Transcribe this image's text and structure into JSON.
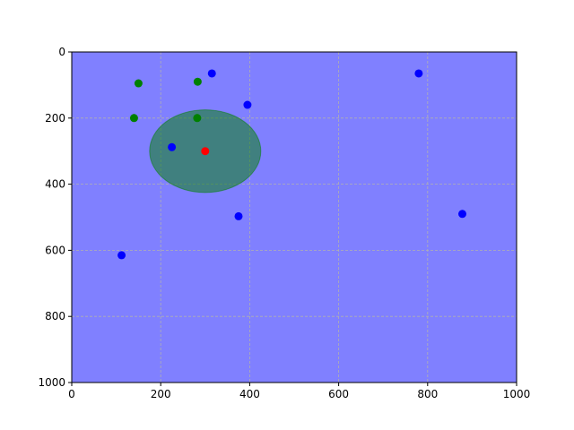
{
  "chart_data": {
    "type": "scatter",
    "title": "",
    "xlabel": "",
    "ylabel": "",
    "xlim": [
      0,
      1000
    ],
    "ylim": [
      1000,
      0
    ],
    "y_inverted": true,
    "grid": true,
    "background_color": "#8080ff",
    "x_ticks": [
      "0",
      "200",
      "400",
      "600",
      "800",
      "1000"
    ],
    "y_ticks": [
      "0",
      "200",
      "400",
      "600",
      "800",
      "1000"
    ],
    "series": [
      {
        "color": "#0000ff",
        "points": [
          [
            315,
            65
          ],
          [
            395,
            160
          ],
          [
            225,
            288
          ],
          [
            375,
            497
          ],
          [
            112,
            615
          ],
          [
            780,
            65
          ],
          [
            878,
            490
          ]
        ]
      },
      {
        "color": "#008000",
        "points": [
          [
            150,
            95
          ],
          [
            283,
            90
          ],
          [
            140,
            200
          ],
          [
            282,
            200
          ]
        ]
      },
      {
        "color": "#ff0000",
        "points": [
          [
            300,
            300
          ]
        ]
      }
    ],
    "shapes": [
      {
        "type": "ellipse",
        "center": [
          300,
          300
        ],
        "width": 250,
        "height": 250,
        "color": "#008000",
        "alpha": 0.5
      }
    ]
  }
}
